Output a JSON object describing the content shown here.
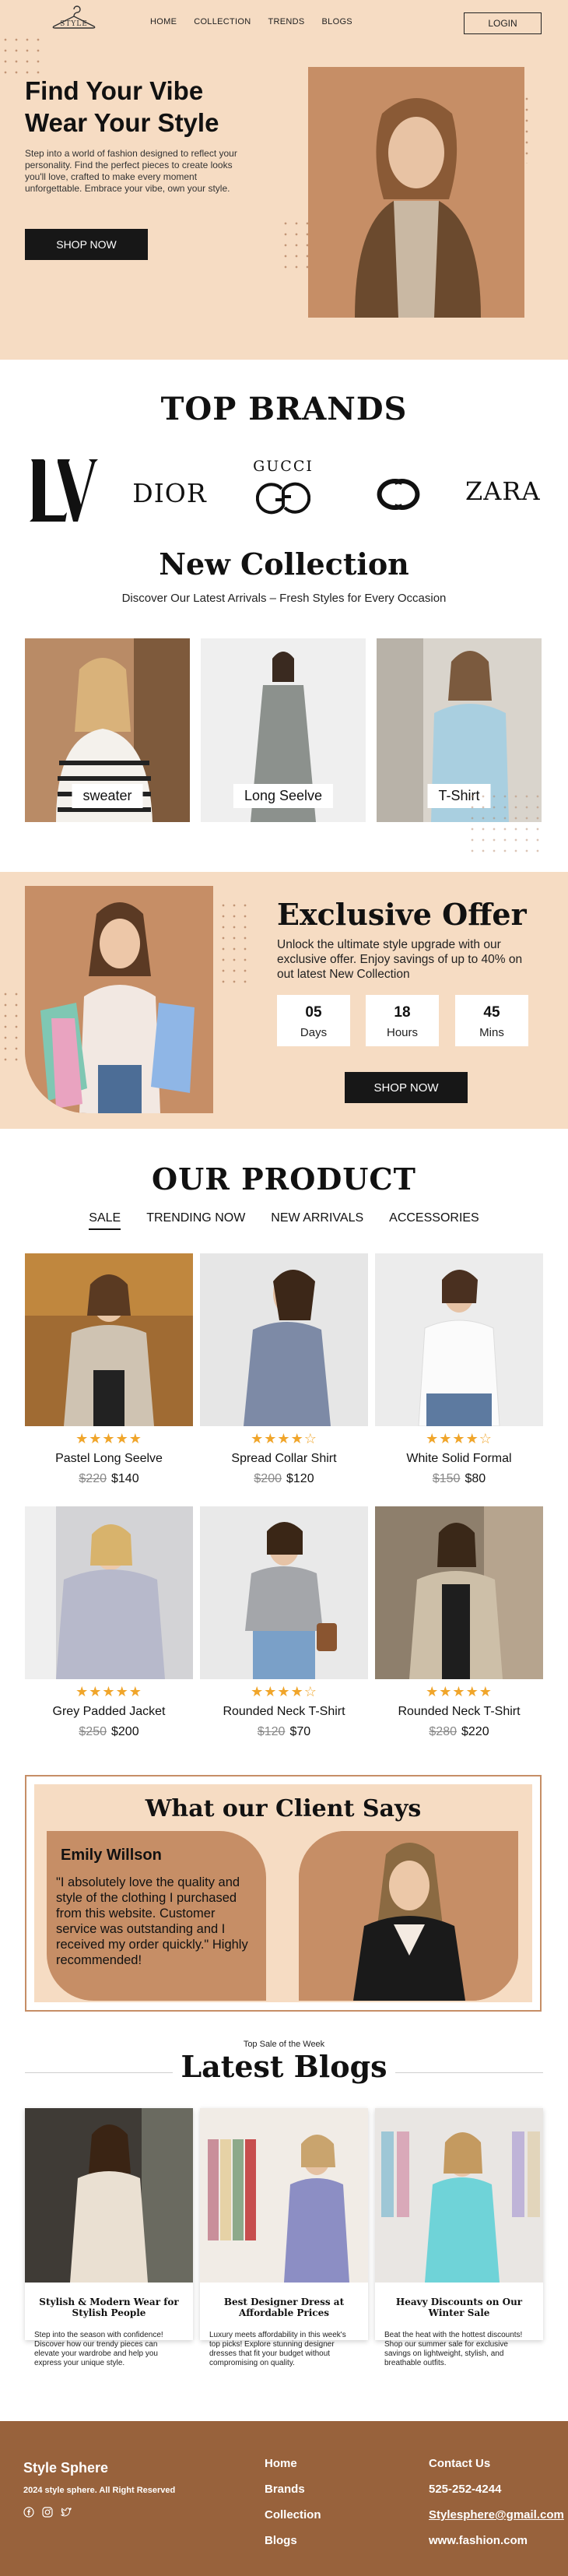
{
  "header": {
    "logo_text": "STYLE",
    "nav": [
      "HOME",
      "COLLECTION",
      "TRENDS",
      "BLOGS"
    ],
    "login_label": "LOGIN"
  },
  "hero": {
    "title_line1": "Find Your Vibe",
    "title_line2": "Wear Your Style",
    "description": "Step into a world of fashion designed to reflect your personality. Find the perfect pieces to create looks you'll love,  crafted to make every moment unforgettable. Embrace your vibe, own your style.",
    "cta": "SHOP NOW"
  },
  "brands": {
    "title": "TOP BRANDS",
    "items": [
      "LV",
      "DIOR",
      "GUCCI",
      "CC",
      "ZARA"
    ]
  },
  "collection": {
    "title": "New Collection",
    "subtitle": "Discover Our Latest Arrivals – Fresh Styles for Every Occasion",
    "items": [
      {
        "label": "sweater"
      },
      {
        "label": "Long Seelve"
      },
      {
        "label": "T-Shirt"
      }
    ]
  },
  "offer": {
    "title": "Exclusive Offer",
    "description": "Unlock the ultimate style upgrade with our exclusive offer. Enjoy savings of up to 40% on out latest New Collection",
    "countdown": [
      {
        "value": "05",
        "unit": "Days"
      },
      {
        "value": "18",
        "unit": "Hours"
      },
      {
        "value": "45",
        "unit": "Mins"
      }
    ],
    "cta": "SHOP NOW"
  },
  "products": {
    "title": "OUR PRODUCT",
    "tabs": [
      "SALE",
      "TRENDING NOW",
      "NEW ARRIVALS",
      "ACCESSORIES"
    ],
    "active_tab": "SALE",
    "items": [
      {
        "name": "Pastel Long Seelve",
        "rating": 5,
        "stars": "★★★★★",
        "old_price": "$220",
        "price": "$140"
      },
      {
        "name": "Spread Collar Shirt",
        "rating": 4,
        "stars": "★★★★☆",
        "old_price": "$200",
        "price": "$120"
      },
      {
        "name": "White Solid Formal",
        "rating": 4,
        "stars": "★★★★☆",
        "old_price": "$150",
        "price": "$80"
      },
      {
        "name": "Grey Padded Jacket",
        "rating": 5,
        "stars": "★★★★★",
        "old_price": "$250",
        "price": "$200"
      },
      {
        "name": "Rounded Neck T-Shirt",
        "rating": 4,
        "stars": "★★★★☆",
        "old_price": "$120",
        "price": "$70"
      },
      {
        "name": "Rounded Neck T-Shirt",
        "rating": 5,
        "stars": "★★★★★",
        "old_price": "$280",
        "price": "$220"
      }
    ]
  },
  "testimonial": {
    "title": "What our Client Says",
    "name": "Emily Willson",
    "quote": "\"I absolutely love the quality and style  of the clothing I purchased from this website. Customer service was outstanding and I received my order quickly.\" Highly recommended!"
  },
  "blogs": {
    "kicker": "Top Sale of the Week",
    "title": "Latest Blogs",
    "items": [
      {
        "title": "Stylish & Modern Wear for Stylish People",
        "desc": "Step into the season with confidence! Discover how our trendy pieces can elevate your wardrobe and help you express your unique style."
      },
      {
        "title": "Best Designer Dress at Affordable Prices",
        "desc": "Luxury meets affordability in this week's top picks! Explore stunning designer dresses that fit your budget without compromising on quality."
      },
      {
        "title": "Heavy Discounts on Our Winter Sale",
        "desc": "Beat the heat with the hottest discounts! Shop our summer sale for exclusive savings on lightweight, stylish, and breathable outfits."
      }
    ]
  },
  "footer": {
    "brand": "Style Sphere",
    "copyright": "2024 style sphere. All Right Reserved",
    "social_icons": [
      "facebook-icon",
      "instagram-icon",
      "twitter-icon"
    ],
    "links": [
      "Home",
      "Brands",
      "Collection",
      "Blogs"
    ],
    "contact_title": "Contact Us",
    "phone": "525-252-4244",
    "email": "Stylesphere@gmail.com",
    "website": "www.fashion.com"
  },
  "colors": {
    "peach": "#f6dcc3",
    "tan": "#c68e66",
    "footer_brown": "#98623c",
    "star": "#f0a52a",
    "dark_button": "#171717"
  }
}
